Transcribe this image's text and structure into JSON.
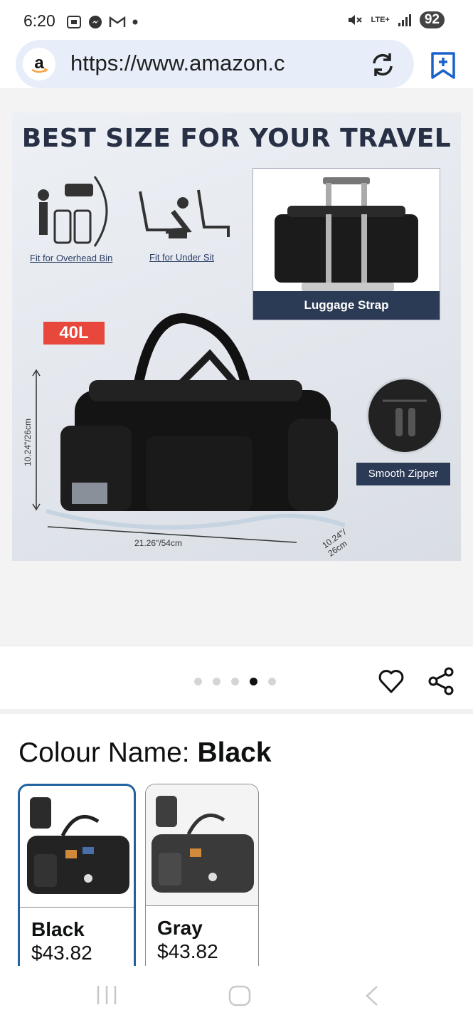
{
  "status": {
    "time": "6:20",
    "network": "LTE+",
    "battery": "92"
  },
  "browser": {
    "url": "https://www.amazon.c",
    "logo_letter": "a"
  },
  "gallery": {
    "headline": "BEST SIZE FOR YOUR TRAVEL",
    "overhead_caption": "Fit for Overhead Bin",
    "undersit_caption": "Fit for Under Sit",
    "strap_label": "Luggage Strap",
    "capacity": "40L",
    "zipper_label": "Smooth Zipper",
    "height_dim": "10.24\"/26cm",
    "length_dim": "21.26\"/54cm",
    "depth_dim": "10.24\"/ 26cm",
    "dot_count": 5,
    "active_dot": 4
  },
  "colour": {
    "label": "Colour Name: ",
    "selected": "Black",
    "options": [
      {
        "name": "Black",
        "price": "$43.82"
      },
      {
        "name": "Gray",
        "price": "$43.82"
      }
    ]
  },
  "colors": {
    "accent_blue": "#2162a1",
    "badge_red": "#e8473c",
    "label_navy": "#2b3a55"
  }
}
